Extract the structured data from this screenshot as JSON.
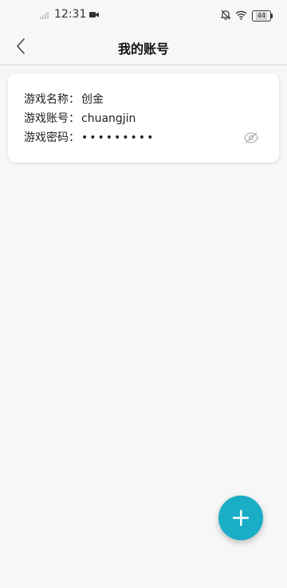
{
  "status_bar": {
    "time": "12:31",
    "battery_level": "44",
    "icons": [
      "signal-icon",
      "video-icon",
      "mute-bell-icon",
      "wifi-icon",
      "battery-icon"
    ]
  },
  "header": {
    "title": "我的账号",
    "back_icon": "chevron-left-icon"
  },
  "account_card": {
    "name_label": "游戏名称：",
    "name_value": "创金",
    "account_label": "游戏账号：",
    "account_value": "chuangjin",
    "password_label": "游戏密码：",
    "password_value": "•••••••••",
    "visibility_icon": "eye-off-icon"
  },
  "fab": {
    "icon": "plus-icon",
    "color": "#19aec6"
  }
}
